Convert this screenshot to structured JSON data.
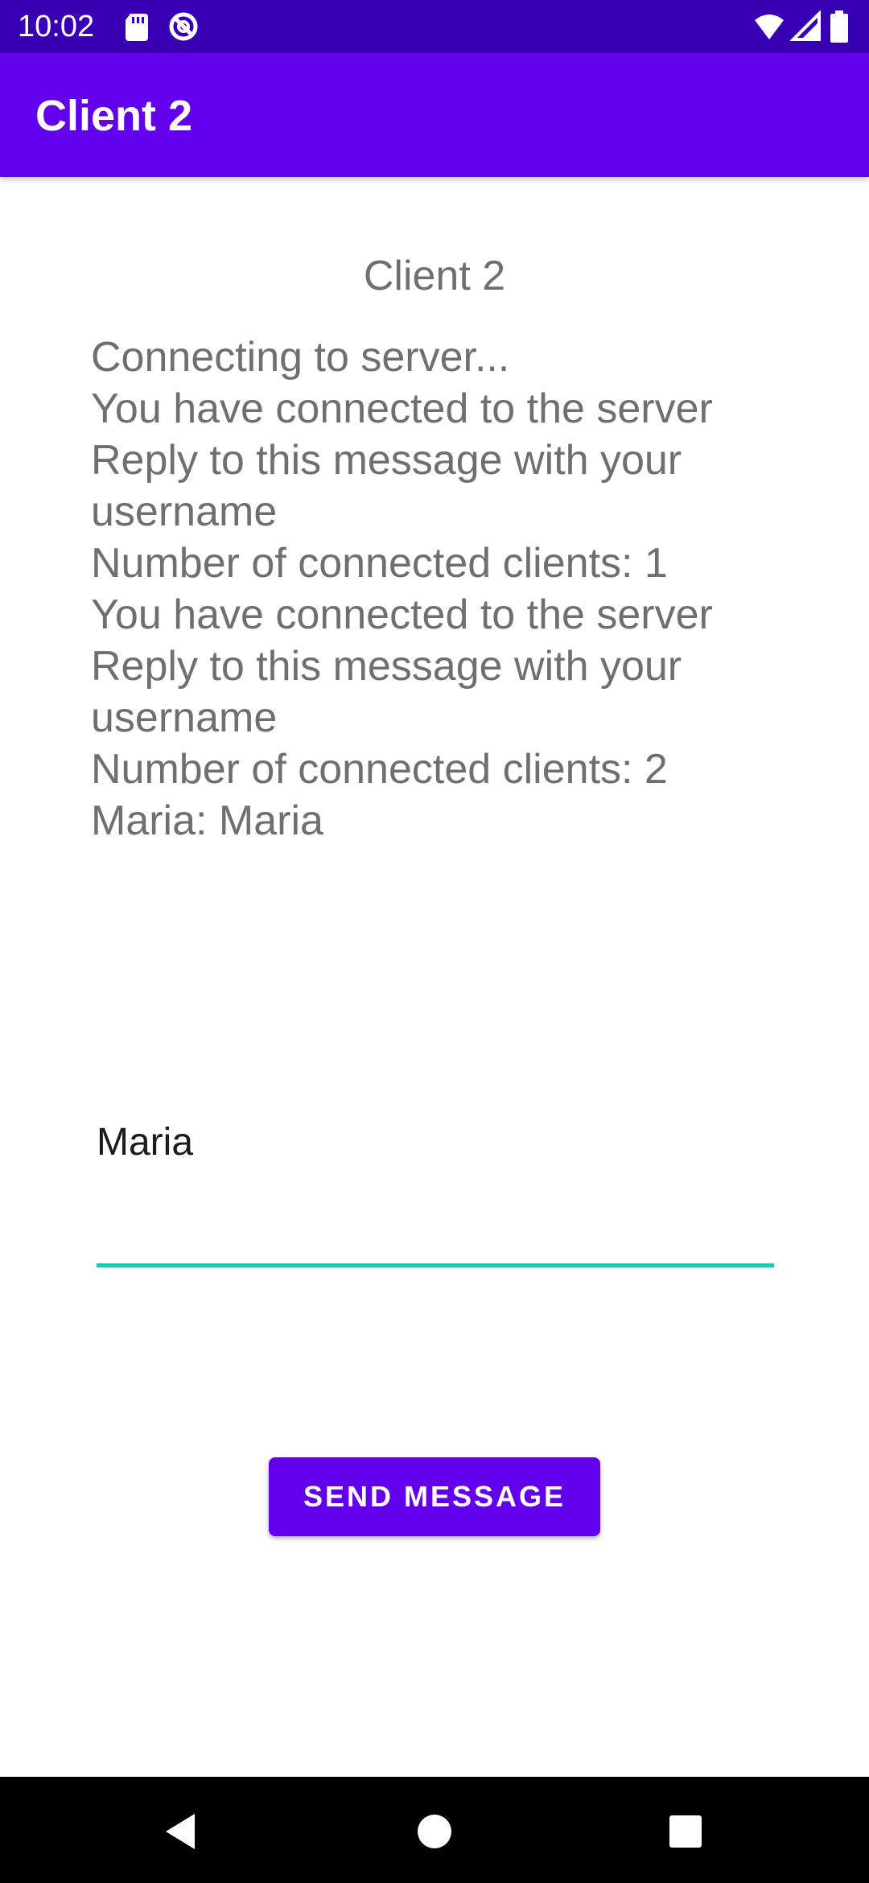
{
  "status_bar": {
    "time": "10:02",
    "icons": [
      "sd-card-icon",
      "sync-off-icon",
      "wifi-icon",
      "signal-icon",
      "battery-icon"
    ]
  },
  "app_bar": {
    "title": "Client 2"
  },
  "main": {
    "client_label": "Client 2",
    "log": [
      "Connecting to server...",
      "You have connected to the server",
      "Reply to this message with your username",
      "Number of connected clients: 1",
      "You have connected to the server",
      "Reply to this message with your username",
      "Number of connected clients: 2",
      "Maria: Maria"
    ],
    "input": {
      "value": "Maria"
    },
    "send_button_label": "SEND MESSAGE"
  },
  "nav_bar": {
    "buttons": [
      "back-icon",
      "home-icon",
      "recents-icon"
    ]
  },
  "colors": {
    "status_bar": "#3700b3",
    "primary": "#6200ee",
    "accent_underline": "#1fc7b6",
    "text_secondary": "#6f6f6f"
  }
}
